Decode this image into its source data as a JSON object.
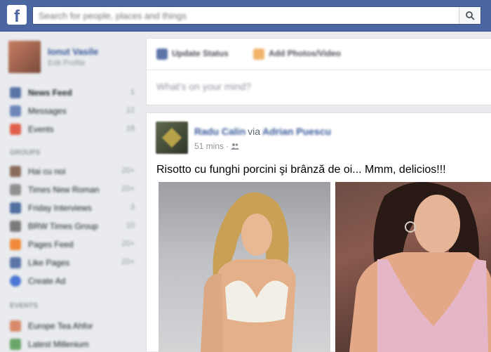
{
  "topbar": {
    "logo": "f",
    "search_placeholder": "Search for people, places and things"
  },
  "sidebar": {
    "profile_name": "Ionut Vasile",
    "profile_edit": "Edit Profile",
    "favorites": [
      {
        "label": "News Feed",
        "count": "1"
      },
      {
        "label": "Messages",
        "count": "12"
      },
      {
        "label": "Events",
        "count": "18"
      }
    ],
    "groups_header": "GROUPS",
    "groups": [
      {
        "label": "Hai cu noi",
        "count": "20+"
      },
      {
        "label": "Times New Roman",
        "count": "20+"
      },
      {
        "label": "Friday Interviews",
        "count": "3"
      },
      {
        "label": "BRW Times Group",
        "count": "10"
      },
      {
        "label": "Pages Feed",
        "count": "20+"
      },
      {
        "label": "Like Pages",
        "count": "20+"
      },
      {
        "label": "Create Ad",
        "count": ""
      }
    ],
    "events_header": "EVENTS",
    "events": [
      {
        "label": "Europe Tea Ahfor",
        "count": ""
      },
      {
        "label": "Latest Millenium",
        "count": ""
      }
    ]
  },
  "composer": {
    "update_status": "Update Status",
    "add_photos": "Add Photos/Video",
    "placeholder": "What's on your mind?"
  },
  "post": {
    "author": "Radu Calin",
    "via": "via",
    "via_name": "Adrian Puescu",
    "time": "51 mins",
    "separator": "·",
    "text": "Risotto cu funghi porcini şi brânză de oi... Mmm, delicios!!!"
  },
  "colors": {
    "topbar": "#4b67a1",
    "link": "#365899",
    "background": "#e9ebee"
  }
}
